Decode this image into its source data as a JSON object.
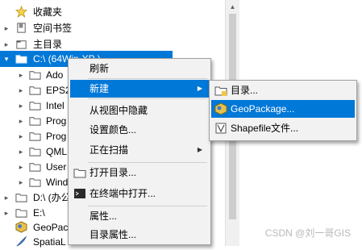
{
  "tree": {
    "items": [
      {
        "label": "收藏夹"
      },
      {
        "label": "空间书签"
      },
      {
        "label": "主目录"
      },
      {
        "label": "C:\\ (64Win-XP )"
      },
      {
        "label": "Ado"
      },
      {
        "label": "EPS2"
      },
      {
        "label": "Intel"
      },
      {
        "label": "Prog"
      },
      {
        "label": "Prog"
      },
      {
        "label": "QML"
      },
      {
        "label": "User"
      },
      {
        "label": "Wind"
      },
      {
        "label": "D:\\ (办公"
      },
      {
        "label": "E:\\"
      },
      {
        "label": "GeoPac"
      },
      {
        "label": "SpatiaL"
      }
    ]
  },
  "context_menu": {
    "refresh": "刷新",
    "new": "新建",
    "hide": "从视图中隐藏",
    "set_color": "设置颜色...",
    "scanning": "正在扫描",
    "open_dir": "打开目录...",
    "open_terminal": "在终端中打开...",
    "properties": "属性...",
    "dir_properties": "目录属性..."
  },
  "submenu": {
    "directory": "目录...",
    "geopackage": "GeoPackage...",
    "shapefile": "Shapefile文件..."
  },
  "watermark": "CSDN @刘一哥GIS",
  "colors": {
    "highlight": "#0078d7",
    "menu_bg": "#f2f2f2"
  }
}
